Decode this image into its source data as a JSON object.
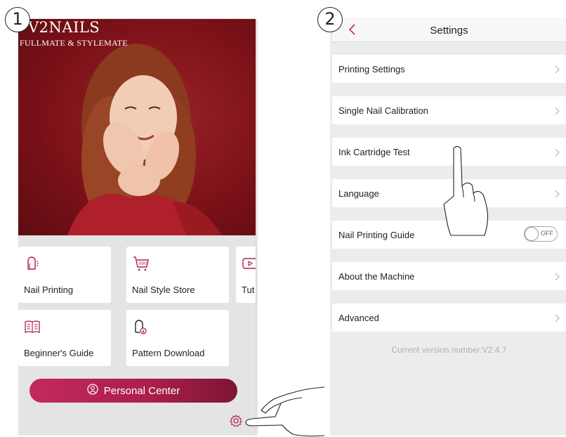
{
  "steps": {
    "step1": "1",
    "step2": "2"
  },
  "home_screen": {
    "brand_title": "V2NAILS",
    "brand_subtitle": "FULLMATE & STYLEMATE",
    "tiles": [
      {
        "label": "Nail Printing",
        "icon": "nail-printing-icon"
      },
      {
        "label": "Nail Style Store",
        "icon": "store-basket-icon"
      },
      {
        "label": "Tut",
        "icon": "tutorial-play-icon"
      },
      {
        "label": "Beginner's Guide",
        "icon": "guide-book-icon"
      },
      {
        "label": "Pattern Download",
        "icon": "pattern-download-icon"
      }
    ],
    "personal_center": {
      "label": "Personal Center",
      "icon": "user-icon"
    },
    "settings_icon": "gear-icon"
  },
  "settings_screen": {
    "title": "Settings",
    "back_icon": "chevron-left-icon",
    "rows": [
      {
        "label": "Printing  Settings",
        "control": "chevron"
      },
      {
        "label": "Single Nail Calibration",
        "control": "chevron"
      },
      {
        "label": "Ink Cartridge Test",
        "control": "chevron"
      },
      {
        "label": "Language",
        "control": "chevron"
      },
      {
        "label": "Nail Printing Guide",
        "control": "toggle",
        "toggle_text": "OFF"
      },
      {
        "label": "About the Machine",
        "control": "chevron"
      },
      {
        "label": "Advanced",
        "control": "chevron"
      }
    ],
    "version": "Current version number:V2.4.7"
  },
  "colors": {
    "accent": "#c3295d",
    "accent_dark": "#7d1433",
    "hero_background": "#7c1218",
    "page_background": "#e4e4e4"
  }
}
